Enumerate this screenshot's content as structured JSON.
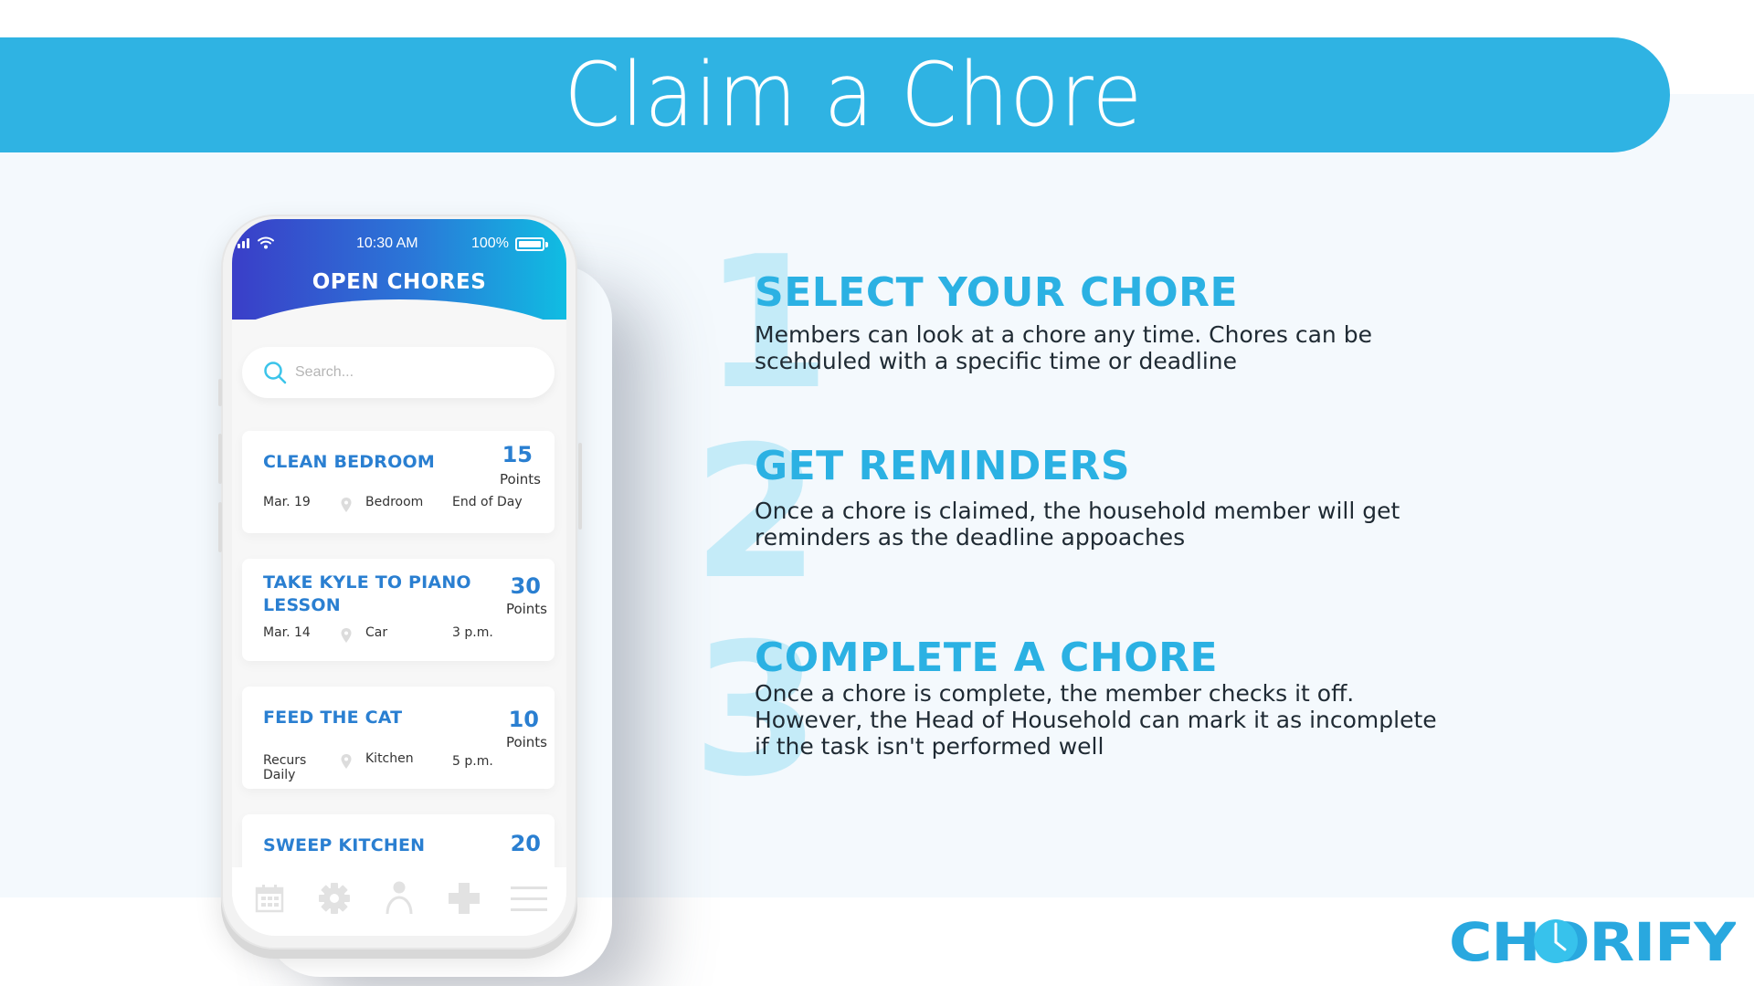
{
  "slide": {
    "title": "Claim a Chore"
  },
  "phone": {
    "status_bar": {
      "time": "10:30 AM",
      "battery": "100%"
    },
    "header_title": "OPEN CHORES",
    "search": {
      "placeholder": "Search..."
    },
    "chores": [
      {
        "title": "CLEAN BEDROOM",
        "points": "15",
        "points_label": "Points",
        "date": "Mar. 19",
        "location": "Bedroom",
        "time": "End of Day"
      },
      {
        "title": "TAKE KYLE TO PIANO LESSON",
        "title_line1": "TAKE KYLE TO PIANO",
        "title_line2": "LESSON",
        "points": "30",
        "points_label": "Points",
        "date": "Mar. 14",
        "location": "Car",
        "time": "3 p.m."
      },
      {
        "title": "FEED THE CAT",
        "points": "10",
        "points_label": "Points",
        "date_line1": "Recurs",
        "date_line2": "Daily",
        "location": "Kitchen",
        "time": "5 p.m."
      },
      {
        "title": "SWEEP KITCHEN",
        "points": "20"
      }
    ],
    "nav": [
      "calendar-icon",
      "gear-icon",
      "user-icon",
      "plus-icon",
      "menu-icon"
    ]
  },
  "steps": [
    {
      "number": "1",
      "heading": "SELECT YOUR CHORE",
      "body": "Members can look at a chore any time. Chores can be scehduled with a specific time or deadline"
    },
    {
      "number": "2",
      "heading": "GET REMINDERS",
      "body": "Once a chore is claimed, the household member will get reminders as the deadline appoaches"
    },
    {
      "number": "3",
      "heading": "COMPLETE A CHORE",
      "body": "Once a chore is complete, the member checks it off. However, the Head of Household can mark it as incomplete if the task isn't performed well"
    }
  ],
  "logo": {
    "text": "CHORIFY"
  },
  "colors": {
    "brand_blue": "#2fb3e3",
    "heading_blue": "#2bb1e3",
    "card_title_blue": "#2a7fd1",
    "step_number": "#c4ebf8",
    "header_gradient_start": "#3a3ec8",
    "header_gradient_end": "#10bde2"
  }
}
